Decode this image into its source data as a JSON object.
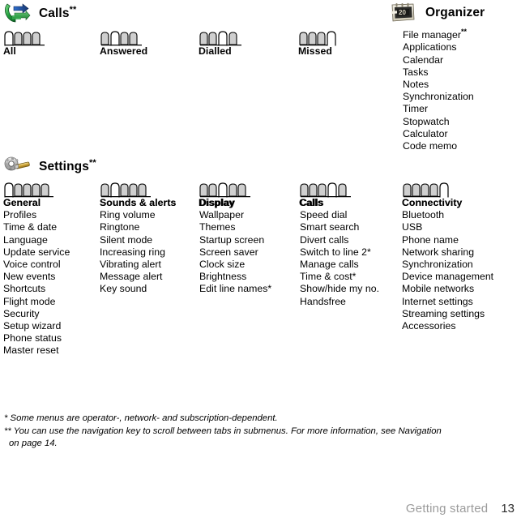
{
  "page": {
    "footer_chapter": "Getting started",
    "footer_page_number": "13"
  },
  "sections": {
    "calls": {
      "title": "Calls",
      "title_stars": "**",
      "icon": "phone-calls-icon",
      "tabs": [
        {
          "label": "All",
          "count": 4,
          "selected": 1
        },
        {
          "label": "Answered",
          "count": 4,
          "selected": 2
        },
        {
          "label": "Dialled",
          "count": 4,
          "selected": 3
        },
        {
          "label": "Missed",
          "count": 4,
          "selected": 4
        }
      ]
    },
    "organizer": {
      "title": "Organizer",
      "icon": "organizer-calendar-icon",
      "items": [
        {
          "label": "File manager",
          "stars": "**"
        },
        {
          "label": "Applications",
          "stars": ""
        },
        {
          "label": "Calendar",
          "stars": ""
        },
        {
          "label": "Tasks",
          "stars": ""
        },
        {
          "label": "Notes",
          "stars": ""
        },
        {
          "label": "Synchronization",
          "stars": ""
        },
        {
          "label": "Timer",
          "stars": ""
        },
        {
          "label": "Stopwatch",
          "stars": ""
        },
        {
          "label": "Calculator",
          "stars": ""
        },
        {
          "label": "Code memo",
          "stars": ""
        }
      ]
    },
    "settings": {
      "title": "Settings",
      "title_stars": "**",
      "icon": "settings-wrench-icon",
      "tabs": [
        {
          "label": "General",
          "count": 5,
          "selected": 1
        },
        {
          "label": "Sounds & alerts",
          "count": 5,
          "selected": 2
        },
        {
          "label": "Display",
          "count": 5,
          "selected": 3
        },
        {
          "label": "Calls",
          "count": 5,
          "selected": 4
        },
        {
          "label": "Connectivity",
          "count": 5,
          "selected": 5
        }
      ],
      "columns": [
        {
          "head": "General",
          "items": [
            "Profiles",
            "Time & date",
            "Language",
            "Update service",
            "Voice control",
            "New events",
            "Shortcuts",
            "Flight mode",
            "Security",
            "Setup wizard",
            "Phone status",
            "Master reset"
          ]
        },
        {
          "head": "Sounds & alerts",
          "items": [
            "Ring volume",
            "Ringtone",
            "Silent mode",
            "Increasing ring",
            "Vibrating alert",
            "Message alert",
            "Key sound"
          ]
        },
        {
          "head": "Display",
          "items": [
            "Wallpaper",
            "Themes",
            "Startup screen",
            "Screen saver",
            "Clock size",
            "Brightness",
            "Edit line names*"
          ]
        },
        {
          "head": "Calls",
          "items": [
            "Speed dial",
            "Smart search",
            "Divert calls",
            "Switch to line 2*",
            "Manage calls",
            "Time & cost*",
            "Show/hide my no.",
            "Handsfree"
          ]
        },
        {
          "head": "Connectivity",
          "items": [
            "Bluetooth",
            "USB",
            "Phone name",
            "Network sharing",
            "Synchronization",
            "Device management",
            "Mobile networks",
            "Internet settings",
            "Streaming settings",
            "Accessories"
          ]
        }
      ]
    }
  },
  "footnotes": [
    "* Some menus are operator-, network- and subscription-dependent.",
    "** You can use the navigation key to scroll between tabs in submenus. For more information, see Navigation",
    "on page 14."
  ],
  "colors": {
    "tab_fill": "#cfcfcf",
    "tab_stroke": "#000000",
    "footer_chapter": "#9b9b9b",
    "footer_page": "#2b2b2b"
  }
}
